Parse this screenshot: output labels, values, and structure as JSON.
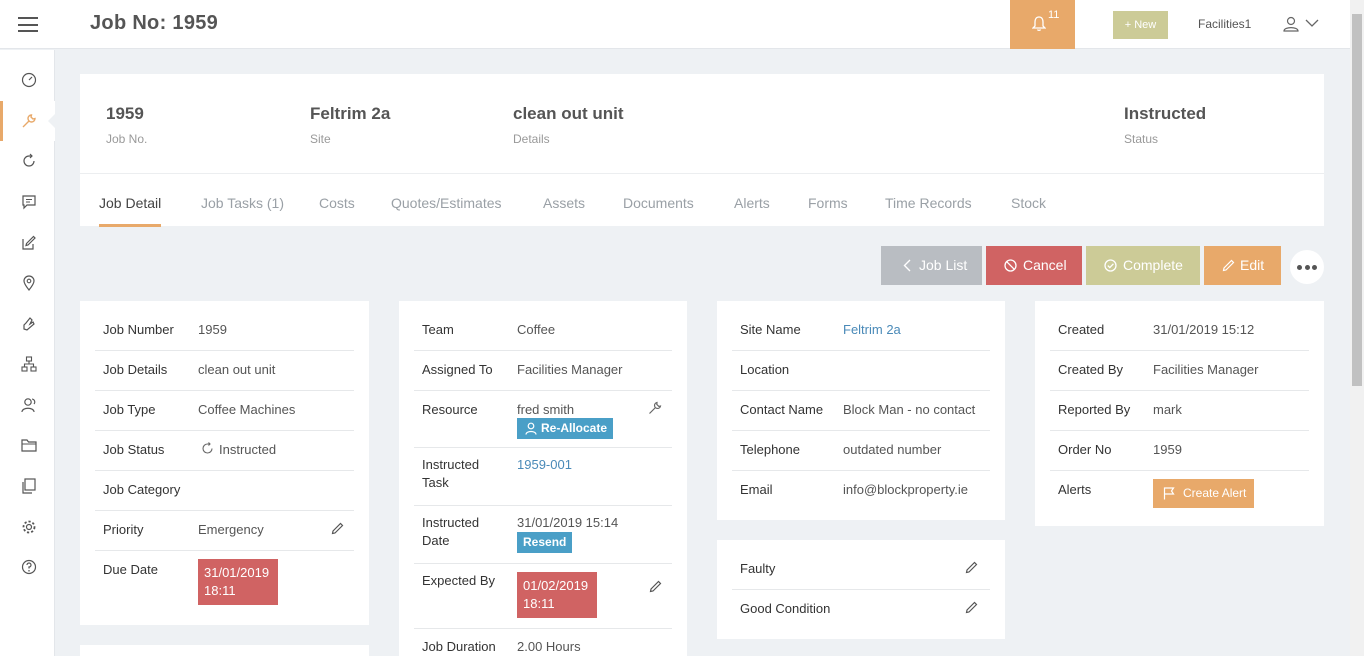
{
  "header": {
    "title": "Job No: 1959",
    "notifications_count": "11",
    "new_label": "+ New",
    "user_name": "Facilities1"
  },
  "sidebar": {
    "icons": [
      "dashboard-icon",
      "wrench-icon",
      "refresh-icon",
      "chat-icon",
      "edit-icon",
      "location-icon",
      "hand-icon",
      "hierarchy-icon",
      "users-icon",
      "folder-icon",
      "documents-icon",
      "settings-icon",
      "help-icon"
    ],
    "active": "wrench-icon"
  },
  "summary": {
    "job_no": "1959",
    "job_no_label": "Job No.",
    "site": "Feltrim 2a",
    "site_label": "Site",
    "details": "clean out unit",
    "details_label": "Details",
    "status": "Instructed",
    "status_label": "Status"
  },
  "tabs": [
    {
      "label": "Job Detail"
    },
    {
      "label": "Job Tasks (1)"
    },
    {
      "label": "Costs"
    },
    {
      "label": "Quotes/Estimates"
    },
    {
      "label": "Assets"
    },
    {
      "label": "Documents"
    },
    {
      "label": "Alerts"
    },
    {
      "label": "Forms"
    },
    {
      "label": "Time Records"
    },
    {
      "label": "Stock"
    }
  ],
  "actions": {
    "job_list": "Job List",
    "cancel": "Cancel",
    "complete": "Complete",
    "edit": "Edit"
  },
  "colors": {
    "accent": "#e8a96a",
    "danger": "#d06363",
    "complete": "#cccb97",
    "info": "#4a9fc7",
    "link": "#4a8ab8"
  },
  "card1": {
    "job_number_label": "Job Number",
    "job_number": "1959",
    "job_details_label": "Job Details",
    "job_details": "clean out unit",
    "job_type_label": "Job Type",
    "job_type": "Coffee Machines",
    "job_status_label": "Job Status",
    "job_status": "Instructed",
    "job_category_label": "Job Category",
    "job_category": "",
    "priority_label": "Priority",
    "priority": "Emergency",
    "due_date_label": "Due Date",
    "due_date_line1": "31/01/2019",
    "due_date_line2": "18:11"
  },
  "card2": {
    "team_label": "Team",
    "team": "Coffee",
    "assigned_to_label": "Assigned To",
    "assigned_to": "Facilities Manager",
    "resource_label": "Resource",
    "resource": "fred smith",
    "reallocate_label": "Re-Allocate",
    "instructed_task_label_1": "Instructed",
    "instructed_task_label_2": "Task",
    "instructed_task": "1959-001",
    "instructed_date_label_1": "Instructed",
    "instructed_date_label_2": "Date",
    "instructed_date": "31/01/2019 15:14",
    "resend_label": "Resend",
    "expected_by_label": "Expected By",
    "expected_by_line1": "01/02/2019",
    "expected_by_line2": "18:11",
    "job_duration_label": "Job Duration",
    "job_duration": "2.00 Hours"
  },
  "card3": {
    "site_name_label": "Site Name",
    "site_name": "Feltrim 2a",
    "location_label": "Location",
    "location": "",
    "contact_name_label": "Contact Name",
    "contact_name": "Block Man - no contact",
    "telephone_label": "Telephone",
    "telephone": "outdated number",
    "email_label": "Email",
    "email": "info@blockproperty.ie"
  },
  "card3b": {
    "faulty_label": "Faulty",
    "good_condition_label": "Good Condition"
  },
  "card4": {
    "created_label": "Created",
    "created": "31/01/2019 15:12",
    "created_by_label": "Created By",
    "created_by": "Facilities Manager",
    "reported_by_label": "Reported By",
    "reported_by": "mark",
    "order_no_label": "Order No",
    "order_no": "1959",
    "alerts_label": "Alerts",
    "create_alert_label": "Create Alert"
  }
}
